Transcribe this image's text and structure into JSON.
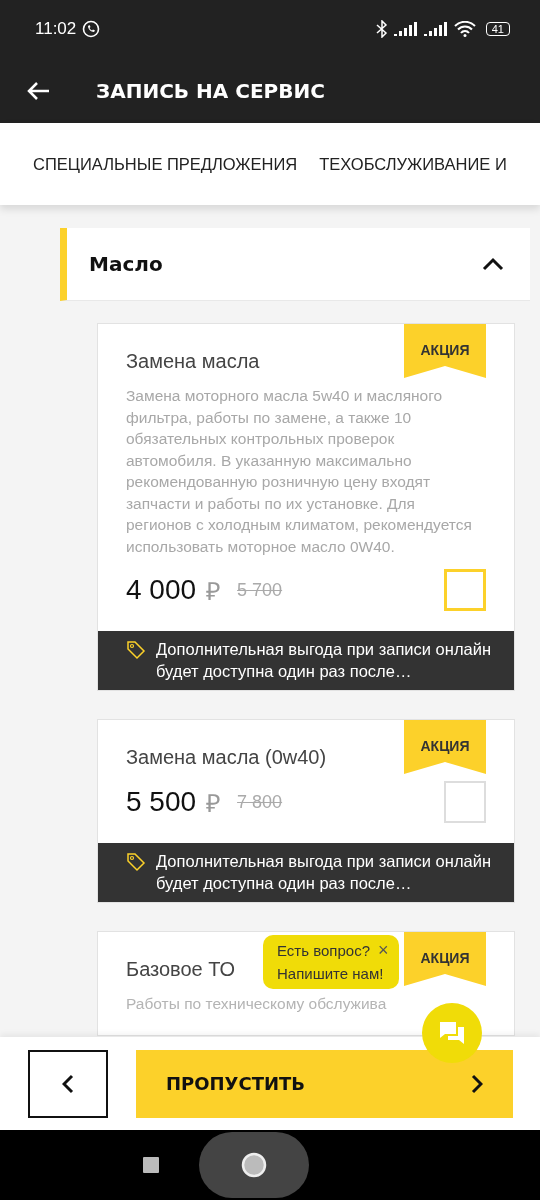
{
  "status_bar": {
    "time": "11:02",
    "battery": "41"
  },
  "app_bar": {
    "title": "ЗАПИСЬ НА СЕРВИС"
  },
  "tabs": [
    {
      "label": "СПЕЦИАЛЬНЫЕ ПРЕДЛОЖЕНИЯ"
    },
    {
      "label": "ТЕХОБСЛУЖИВАНИЕ И"
    }
  ],
  "section": {
    "title": "Масло",
    "expanded": true
  },
  "services": [
    {
      "title": "Замена масла",
      "badge": "АКЦИЯ",
      "description": "Замена моторного масла 5w40 и масляного фильтра, работы по замене, а также 10 обязательных контрольных проверок автомобиля. В указанную максимально рекомендованную розничную цену входят запчасти и работы по их установке. Для регионов с холодным климатом, рекомендуется использовать моторное масло 0W40.",
      "price": "4 000",
      "currency": "₽",
      "old_price": "5 700",
      "checked": false,
      "highlighted": true,
      "note": "Дополнительная выгода при записи онлайн будет доступна один раз после…"
    },
    {
      "title": "Замена масла (0w40)",
      "badge": "АКЦИЯ",
      "price": "5 500",
      "currency": "₽",
      "old_price": "7 800",
      "checked": false,
      "highlighted": false,
      "note": "Дополнительная выгода при записи онлайн будет доступна один раз после…"
    },
    {
      "title": "Базовое ТО",
      "badge": "АКЦИЯ",
      "description": "Работы по техническому обслужива"
    }
  ],
  "chat": {
    "line1": "Есть вопрос?",
    "close": "×",
    "line2": "Напишите нам!"
  },
  "bottom_bar": {
    "skip": "ПРОПУСТИТЬ"
  }
}
